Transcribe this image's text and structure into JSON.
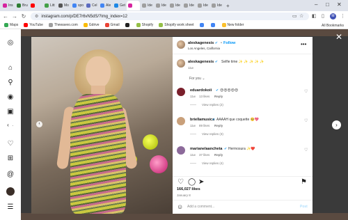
{
  "browser": {
    "tabs": [
      {
        "label": "Ins",
        "color": "#d6249f",
        "active": false
      },
      {
        "label": "Bru",
        "color": "#2e7d32",
        "active": false
      },
      {
        "label": "",
        "color": "#ff0000",
        "active": false
      },
      {
        "label": "Litt",
        "color": "#43a047",
        "active": false
      },
      {
        "label": "Mo",
        "color": "#555555",
        "active": false
      },
      {
        "label": "spo",
        "color": "#4285f4",
        "active": false
      },
      {
        "label": "Cel",
        "color": "#5c6bc0",
        "active": false
      },
      {
        "label": "Ale",
        "color": "#4285f4",
        "active": false
      },
      {
        "label": "Get",
        "color": "#1e88e5",
        "active": false
      },
      {
        "label": "",
        "color": "#d6249f",
        "active": true
      },
      {
        "label": "Ide",
        "color": "#9e9e9e",
        "active": false
      },
      {
        "label": "Ide",
        "color": "#9e9e9e",
        "active": false
      },
      {
        "label": "Ide",
        "color": "#9e9e9e",
        "active": false
      },
      {
        "label": "Ide",
        "color": "#9e9e9e",
        "active": false
      },
      {
        "label": "Ide",
        "color": "#9e9e9e",
        "active": false
      },
      {
        "label": "Ide",
        "color": "#9e9e9e",
        "active": false
      }
    ],
    "new_tab": "+",
    "url": "instagram.com/p/DE7r6vN5dS/?img_index=12",
    "profile_initial": "M",
    "bookmarks": [
      {
        "label": "Maps",
        "color": "#34a853"
      },
      {
        "label": "YouTube",
        "color": "#ff0000"
      },
      {
        "label": "Thewaveo.com",
        "color": "#9e9e9e"
      },
      {
        "label": "Gdrive",
        "color": "#fbbc04"
      },
      {
        "label": "Gmail",
        "color": "#ea4335"
      },
      {
        "label": "",
        "color": "#212121"
      },
      {
        "label": "Shopify",
        "color": "#95bf47"
      },
      {
        "label": "Shopify work sheet",
        "color": "#95bf47"
      },
      {
        "label": "",
        "color": "#4285f4"
      },
      {
        "label": "",
        "color": "#4285f4"
      },
      {
        "label": "New folder",
        "color": "#fbc02d"
      }
    ],
    "all_bookmarks": "All Bookmarks"
  },
  "post": {
    "author": "aleskagenesis",
    "follow_label": "Follow",
    "location": "Los Angeles, California",
    "caption": "Selfie time ✨ ✨ ✨ ✨ ✨",
    "caption_time": "11w",
    "for_you_label": "For you",
    "comments": [
      {
        "user": "eduardokoii",
        "text": "😍😍😍😍😍",
        "time": "11w",
        "likes": "13 likes",
        "reply": "Reply",
        "view_replies": "View replies (2)"
      },
      {
        "user": "briellamusica",
        "text": "AAAAH que coquette 🥺💖",
        "time": "11w",
        "likes": "89 likes",
        "reply": "Reply",
        "view_replies": "View replies (3)"
      },
      {
        "user": "marianelaancheta",
        "text": "Hermosura ✨❤️",
        "time": "11w",
        "likes": "37 likes",
        "reply": "Reply",
        "view_replies": "View replies (4)"
      }
    ],
    "like_count": "166,027 likes",
    "date": "January 8",
    "comment_placeholder": "Add a comment...",
    "post_button": "Post"
  }
}
